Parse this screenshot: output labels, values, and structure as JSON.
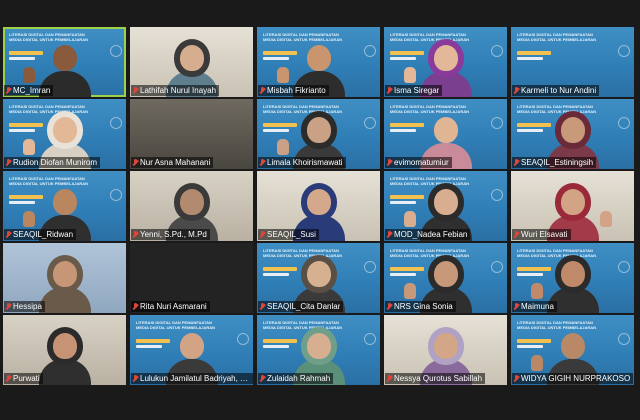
{
  "meeting": {
    "participants": [
      {
        "name": "MC_Imran",
        "bg": "slide",
        "active": true,
        "skin": "#8a5a3c",
        "shirt": "#2b2b2b",
        "veil": "",
        "gesture": "left"
      },
      {
        "name": "Lathifah Nurul Inayah",
        "bg": "light",
        "active": false,
        "skin": "#d6ad8e",
        "shirt": "#5f7f8f",
        "veil": "#3a3a3a",
        "gesture": ""
      },
      {
        "name": "Misbah Fikrianto",
        "bg": "slide",
        "active": false,
        "skin": "#c9956e",
        "shirt": "#2d2d2d",
        "veil": "",
        "gesture": "left"
      },
      {
        "name": "Isma Siregar",
        "bg": "slide",
        "active": false,
        "skin": "#e2b898",
        "shirt": "#7a3f8f",
        "veil": "#8a3a9a",
        "gesture": "left"
      },
      {
        "name": "Karmeli to Nur Andini",
        "bg": "slide",
        "active": false,
        "skin": "",
        "shirt": "",
        "veil": "",
        "gesture": ""
      },
      {
        "name": "Rudion Diofan Munirom",
        "bg": "slide",
        "active": false,
        "skin": "#e3b896",
        "shirt": "#d9d0c4",
        "veil": "#e8e2d8",
        "gesture": "left"
      },
      {
        "name": "Nur Asna Mahanani",
        "bg": "room",
        "active": false,
        "skin": "",
        "shirt": "",
        "veil": "",
        "gesture": ""
      },
      {
        "name": "Limala Khoirismawati",
        "bg": "slide",
        "active": false,
        "skin": "#caa184",
        "shirt": "#3a3a3a",
        "veil": "#2b2b2b",
        "gesture": "left"
      },
      {
        "name": "evimomatumiur",
        "bg": "slide",
        "active": false,
        "skin": "#e0b594",
        "shirt": "#c98a9a",
        "veil": "",
        "gesture": ""
      },
      {
        "name": "SEAQIL_Estiningsih",
        "bg": "slide",
        "active": false,
        "skin": "#c99a7a",
        "shirt": "#7a3a4a",
        "veil": "#6a2a3a",
        "gesture": ""
      },
      {
        "name": "SEAQIL_Ridwan",
        "bg": "slide",
        "active": false,
        "skin": "#b9865f",
        "shirt": "#2f2f2f",
        "veil": "",
        "gesture": "left"
      },
      {
        "name": "Yenni, S.Pd., M.Pd",
        "bg": "wall",
        "active": false,
        "skin": "#b28a70",
        "shirt": "#4a4a4a",
        "veil": "#3a3a3a",
        "gesture": ""
      },
      {
        "name": "SEAQIL_Susi",
        "bg": "light",
        "active": false,
        "skin": "#d4a88a",
        "shirt": "#2a3b7a",
        "veil": "#2a3b7a",
        "gesture": ""
      },
      {
        "name": "MOD_Nadea Febian",
        "bg": "slide",
        "active": false,
        "skin": "#d9ae90",
        "shirt": "#2f2f2f",
        "veil": "#2b2b2b",
        "gesture": "left"
      },
      {
        "name": "Wuri Elsavati",
        "bg": "light",
        "active": false,
        "skin": "#d2a384",
        "shirt": "#a33a4a",
        "veil": "#9a2a3a",
        "gesture": "right"
      },
      {
        "name": "Hessipa",
        "bg": "photo",
        "active": false,
        "skin": "#c79677",
        "shirt": "#6a5a4a",
        "veil": "#6a5a4a",
        "gesture": ""
      },
      {
        "name": "Rita Nuri Asmarani",
        "bg": "dark",
        "active": false,
        "skin": "",
        "shirt": "",
        "veil": "",
        "gesture": ""
      },
      {
        "name": "SEAQIL_Cita Danlar",
        "bg": "slide",
        "active": false,
        "skin": "#d6b08f",
        "shirt": "#3a3a3a",
        "veil": "#5a4f44",
        "gesture": ""
      },
      {
        "name": "NRS Gina Sonia",
        "bg": "slide",
        "active": false,
        "skin": "#c7987a",
        "shirt": "#2f2f2f",
        "veil": "#2b2b2b",
        "gesture": "left"
      },
      {
        "name": "Maimuna",
        "bg": "slide",
        "active": false,
        "skin": "#c08a6a",
        "shirt": "#2f2f2f",
        "veil": "#2b2b2b",
        "gesture": "left"
      },
      {
        "name": "Purwati",
        "bg": "wall",
        "active": false,
        "skin": "#c69474",
        "shirt": "#2f2f2f",
        "veil": "#2b2b2b",
        "gesture": ""
      },
      {
        "name": "Lulukun Jamilatul Badriyah, S.Pd",
        "bg": "slide",
        "active": false,
        "skin": "#d2a485",
        "shirt": "#3a3a3a",
        "veil": "",
        "gesture": ""
      },
      {
        "name": "Zulaidah Rahmah",
        "bg": "slide",
        "active": false,
        "skin": "#d8ae90",
        "shirt": "#5a8f7a",
        "veil": "#6f9f8a",
        "gesture": ""
      },
      {
        "name": "Nessya Qurotus Sabillah",
        "bg": "light",
        "active": false,
        "skin": "#d3a688",
        "shirt": "#8a6a9a",
        "veil": "#b0a2c4",
        "gesture": ""
      },
      {
        "name": "WIDYA GIGIH NURPRAKOSO",
        "bg": "slide",
        "active": false,
        "skin": "#b98866",
        "shirt": "#3a3a3a",
        "veil": "",
        "gesture": "left"
      }
    ],
    "slide_caption": "LITERASI DIGITAL DAN PEMANFAATAN MEDIA DIGITAL UNTUK PEMBELAJARAN"
  }
}
